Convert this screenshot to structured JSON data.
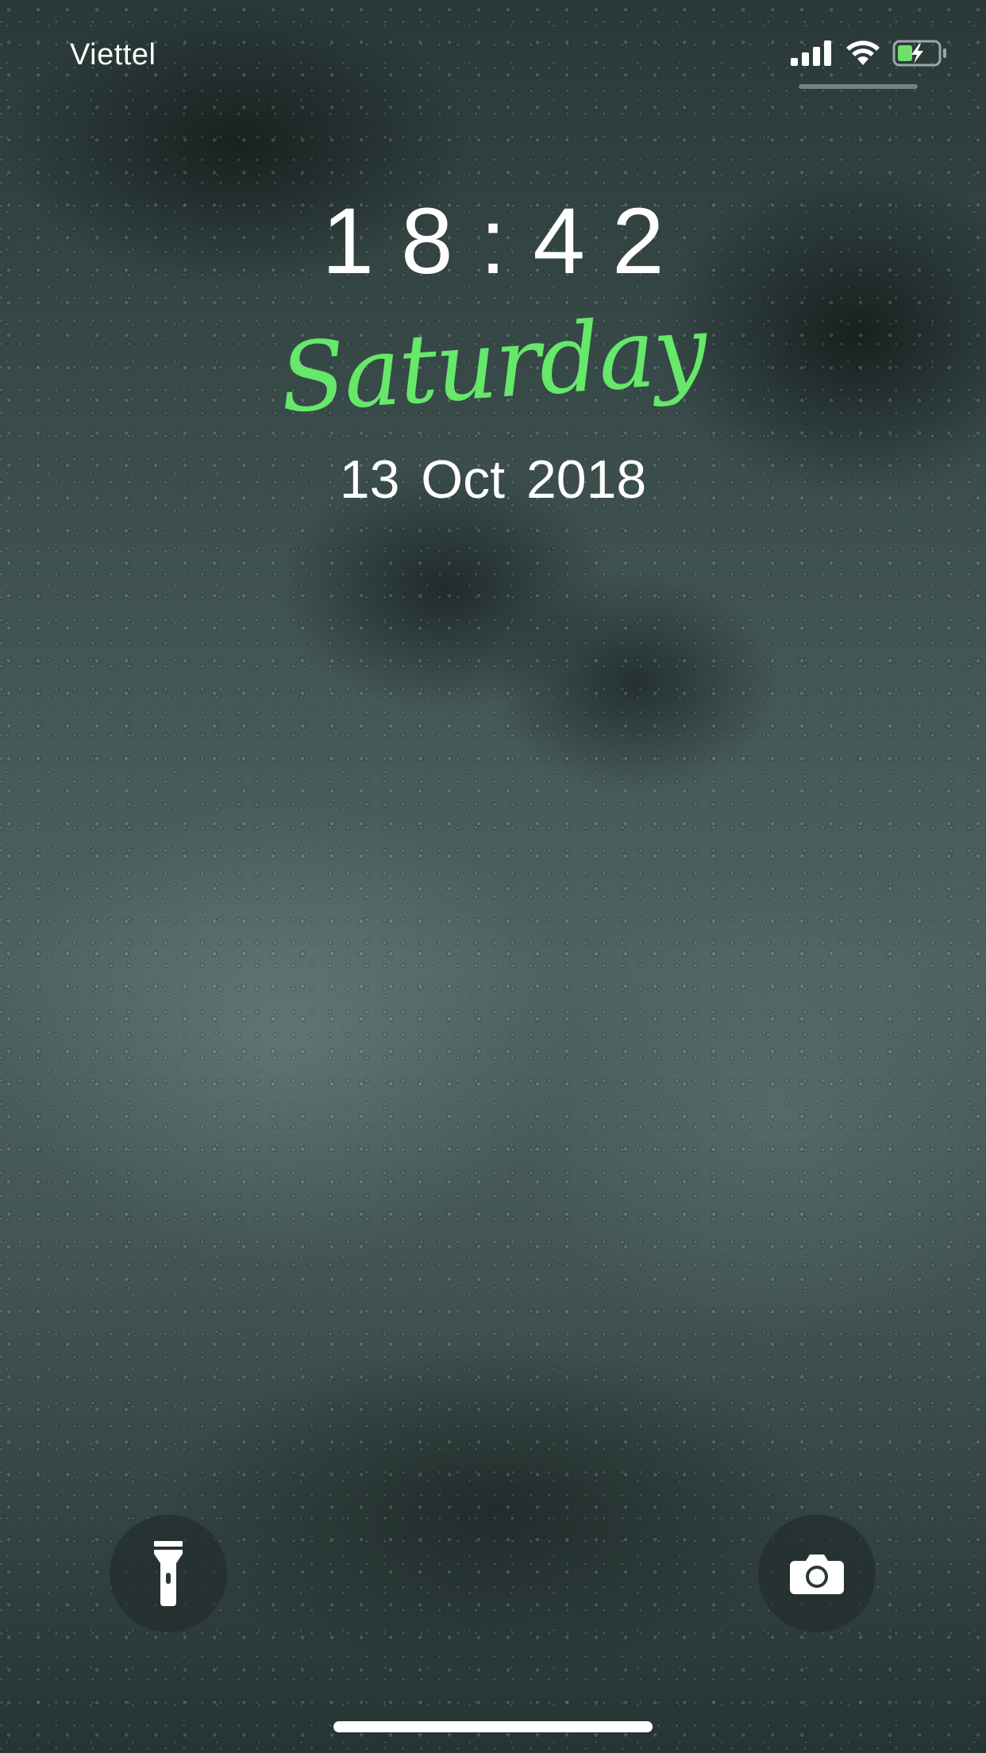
{
  "status_bar": {
    "carrier": "Viettel",
    "icons": [
      "cellular-signal-icon",
      "wifi-icon",
      "battery-charging-icon"
    ],
    "battery_color": "#6fe06a"
  },
  "lock_screen": {
    "time": "18:42",
    "day": "Saturday",
    "date": "13 Oct  2018",
    "day_color": "#66e86a"
  },
  "quick_actions": {
    "left_icon": "flashlight-icon",
    "right_icon": "camera-icon"
  }
}
